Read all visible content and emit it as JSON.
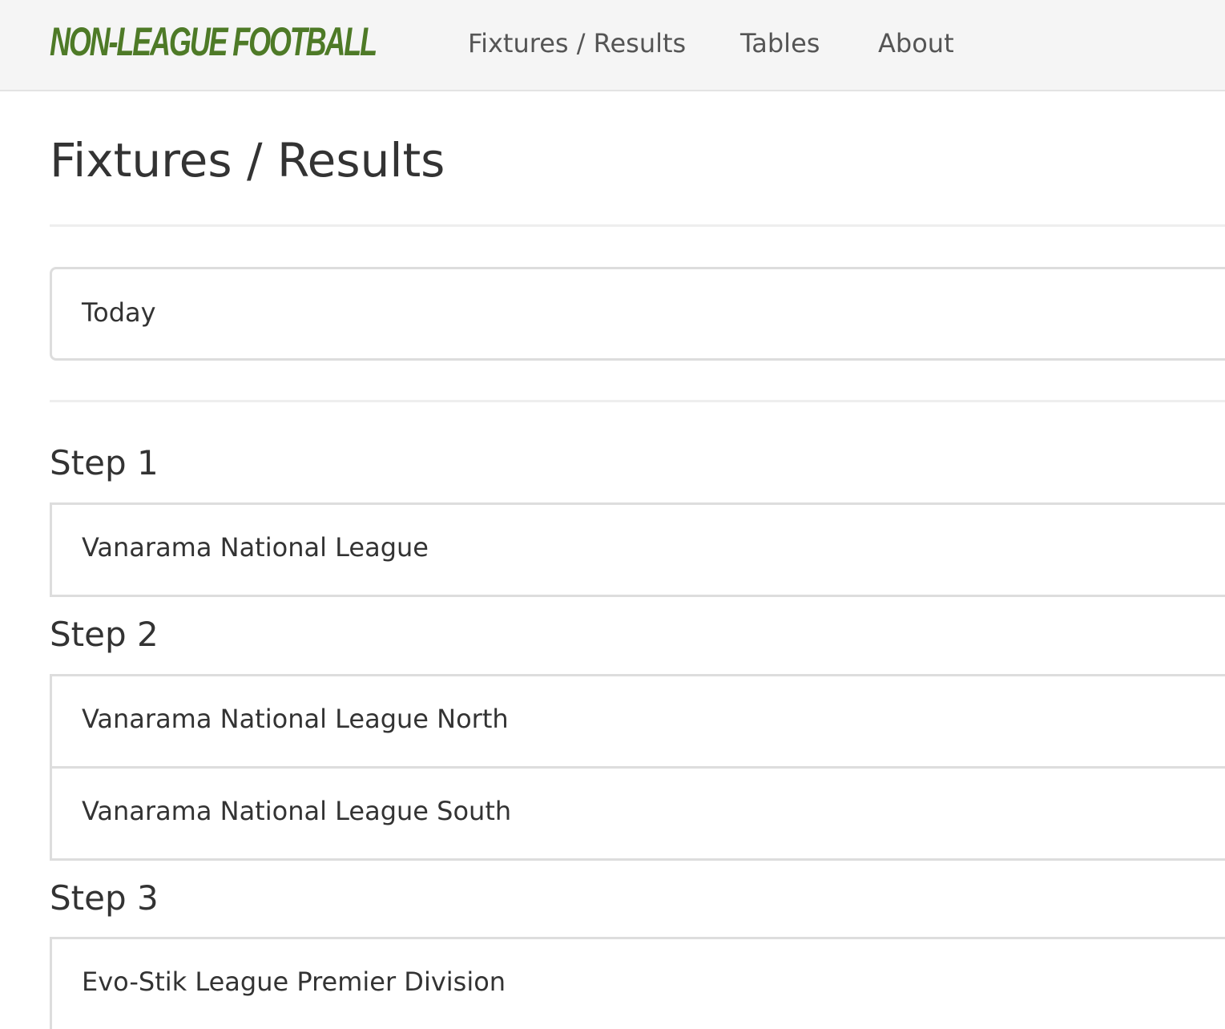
{
  "navbar": {
    "brand": "NON-LEAGUE FOOTBALL",
    "links": [
      {
        "label": "Fixtures / Results"
      },
      {
        "label": "Tables"
      },
      {
        "label": "About"
      }
    ]
  },
  "page": {
    "title": "Fixtures / Results",
    "today_label": "Today"
  },
  "steps": [
    {
      "heading": "Step 1",
      "leagues": [
        "Vanarama National League"
      ]
    },
    {
      "heading": "Step 2",
      "leagues": [
        "Vanarama National League North",
        "Vanarama National League South"
      ]
    },
    {
      "heading": "Step 3",
      "leagues": [
        "Evo-Stik League Premier Division"
      ]
    }
  ],
  "colors": {
    "brand": "#4e7a27",
    "navbar_bg": "#f5f5f5",
    "text": "#333333",
    "border": "#dddddd"
  }
}
